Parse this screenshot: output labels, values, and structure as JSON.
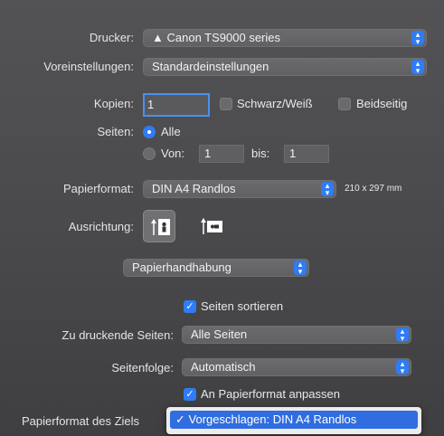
{
  "printer": {
    "label": "Drucker:",
    "value": "Canon TS9000 series"
  },
  "presets": {
    "label": "Voreinstellungen:",
    "value": "Standardeinstellungen"
  },
  "copies": {
    "label": "Kopien:",
    "value": "1",
    "bw_label": "Schwarz/Weiß",
    "duplex_label": "Beidseitig"
  },
  "pages": {
    "label": "Seiten:",
    "all_label": "Alle",
    "from_label": "Von:",
    "from_value": "1",
    "to_label": "bis:",
    "to_value": "1"
  },
  "paper_size": {
    "label": "Papierformat:",
    "value": "DIN A4 Randlos",
    "dimensions": "210 x 297 mm"
  },
  "orientation": {
    "label": "Ausrichtung:"
  },
  "section": {
    "value": "Papierhandhabung"
  },
  "collate": {
    "label": "Seiten sortieren"
  },
  "pages_to_print": {
    "label": "Zu druckende Seiten:",
    "value": "Alle Seiten"
  },
  "page_order": {
    "label": "Seitenfolge:",
    "value": "Automatisch"
  },
  "scale_to_fit": {
    "label": "An Papierformat anpassen"
  },
  "dest_paper": {
    "label": "Papierformat des Ziels",
    "selected": "✓ Vorgeschlagen: DIN A4 Randlos"
  },
  "colors": {
    "accent": "#2f7cf6",
    "menu_highlight": "#2f6de0"
  }
}
